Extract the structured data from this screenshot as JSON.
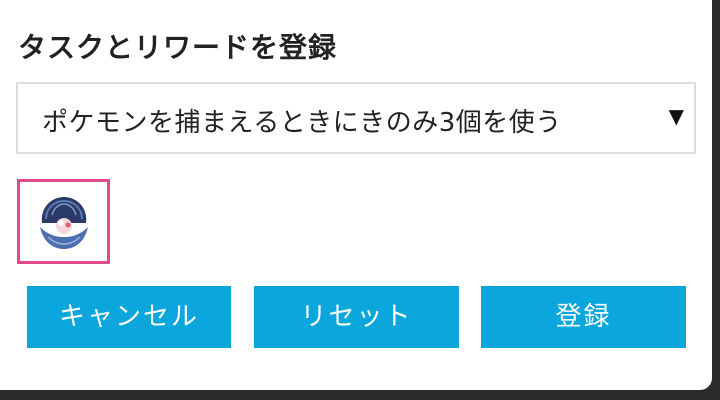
{
  "dialog": {
    "title": "タスクとリワードを登録"
  },
  "task_select": {
    "selected_value": "ポケモンを捕まえるときにきのみ3個を使う",
    "arrow": "▼"
  },
  "reward": {
    "icon": "clamperl-pokemon-icon",
    "selected": true,
    "highlight_color": "#e24a8a"
  },
  "buttons": {
    "cancel_label": "キャンセル",
    "reset_label": "リセット",
    "register_label": "登録",
    "color": "#0aa6dc"
  }
}
